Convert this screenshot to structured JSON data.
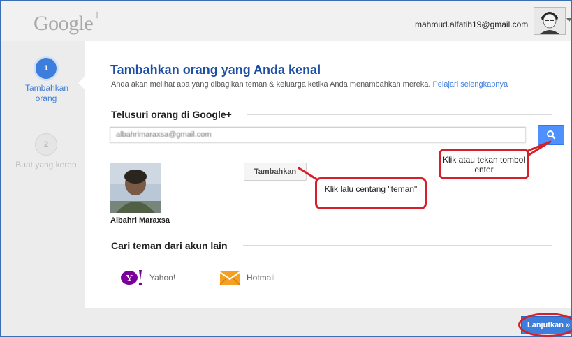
{
  "header": {
    "logo_text": "Google",
    "logo_plus": "+",
    "account_email": "mahmud.alfatih19@gmail.com"
  },
  "steps": [
    {
      "number": "1",
      "label": "Tambahkan orang",
      "state": "active"
    },
    {
      "number": "2",
      "label": "Buat yang keren",
      "state": "inactive"
    }
  ],
  "main": {
    "title": "Tambahkan orang yang Anda kenal",
    "subtitle": "Anda akan melihat apa yang dibagikan teman & keluarga ketika Anda menambahkan mereka.",
    "learn_more": "Pelajari selengkapnya",
    "search_section_title": "Telusuri orang di Google+",
    "search_value": "albahrimaraxsa@gmail.com",
    "search_result": {
      "name": "Albahri Maraxsa",
      "add_label": "Tambahkan"
    },
    "other_accounts_title": "Cari teman dari akun lain",
    "accounts": [
      {
        "name": "Yahoo!",
        "icon": "yahoo-logo"
      },
      {
        "name": "Hotmail",
        "icon": "hotmail-envelope"
      }
    ],
    "continue_label": "Lanjutkan »"
  },
  "annotations": {
    "search_callout": "Klik atau tekan tombol enter",
    "add_callout": "Klik lalu centang \"teman\""
  },
  "colors": {
    "accent": "#3d7ddb",
    "title": "#1d4fa3",
    "annotation_red": "#d5202a"
  }
}
